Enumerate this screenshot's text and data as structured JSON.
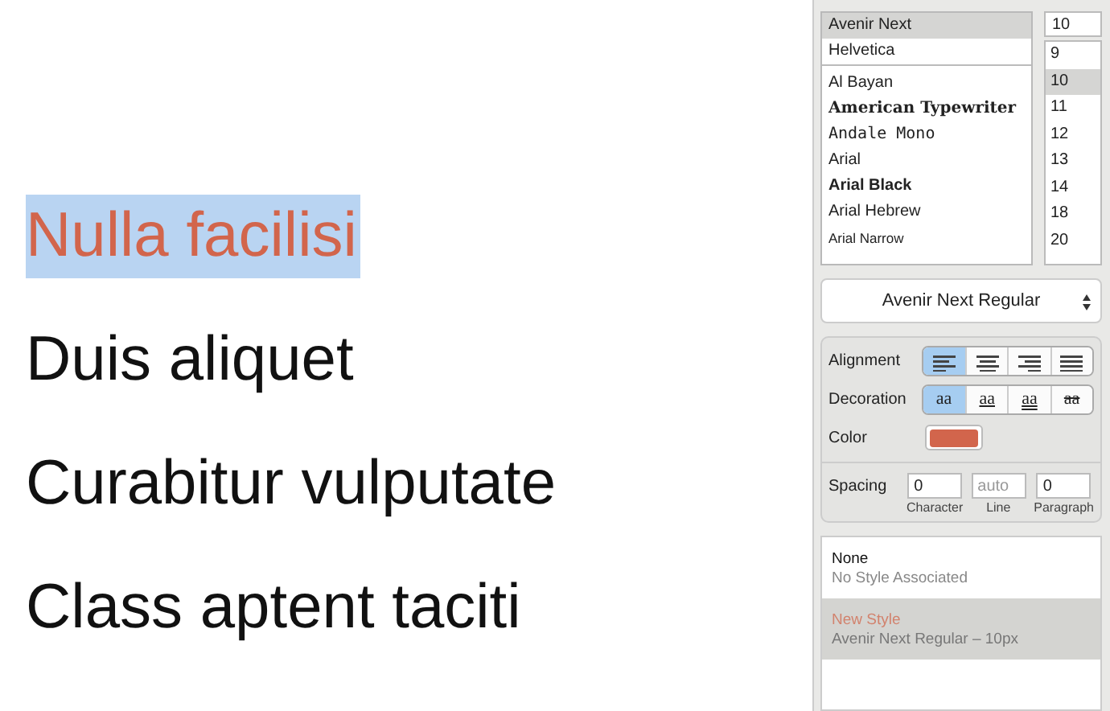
{
  "document": {
    "lines": [
      {
        "text": "Nulla facilisi",
        "selected": true
      },
      {
        "text": "Duis aliquet",
        "selected": false
      },
      {
        "text": "Curabitur vulputate",
        "selected": false
      },
      {
        "text": "Class aptent taciti",
        "selected": false
      }
    ]
  },
  "fonts": {
    "families": [
      {
        "name": "Avenir Next",
        "selected": true
      },
      {
        "name": "Helvetica",
        "selected": false
      },
      {
        "name": "Al Bayan",
        "selected": false
      },
      {
        "name": "American Typewriter",
        "selected": false
      },
      {
        "name": "Andale Mono",
        "selected": false
      },
      {
        "name": "Arial",
        "selected": false
      },
      {
        "name": "Arial Black",
        "selected": false
      },
      {
        "name": "Arial Hebrew",
        "selected": false
      },
      {
        "name": "Arial Narrow",
        "selected": false
      }
    ],
    "size_field": "10",
    "sizes": [
      {
        "label": "9",
        "selected": false
      },
      {
        "label": "10",
        "selected": true
      },
      {
        "label": "11",
        "selected": false
      },
      {
        "label": "12",
        "selected": false
      },
      {
        "label": "13",
        "selected": false
      },
      {
        "label": "14",
        "selected": false
      },
      {
        "label": "18",
        "selected": false
      },
      {
        "label": "20",
        "selected": false
      }
    ],
    "typeface": "Avenir Next Regular"
  },
  "alignment": {
    "label": "Alignment",
    "options": [
      {
        "kind": "left",
        "selected": true
      },
      {
        "kind": "center",
        "selected": false
      },
      {
        "kind": "right",
        "selected": false
      },
      {
        "kind": "justify",
        "selected": false
      }
    ]
  },
  "decoration": {
    "label": "Decoration",
    "options": [
      {
        "kind": "none",
        "text": "aa",
        "selected": true
      },
      {
        "kind": "underline",
        "text": "aa",
        "selected": false
      },
      {
        "kind": "double",
        "text": "aa",
        "selected": false
      },
      {
        "kind": "strike",
        "text": "aa",
        "selected": false
      }
    ]
  },
  "color": {
    "label": "Color",
    "color": "#d2654c"
  },
  "spacing": {
    "label": "Spacing",
    "fields": [
      {
        "value": "0",
        "caption": "Character"
      },
      {
        "placeholder": "auto",
        "caption": "Line"
      },
      {
        "value": "0",
        "caption": "Paragraph"
      }
    ]
  },
  "styles": [
    {
      "name": "None",
      "description": "No Style Associated",
      "selected": false
    },
    {
      "name": "New Style",
      "description": "Avenir Next Regular – 10px",
      "selected": true
    }
  ]
}
